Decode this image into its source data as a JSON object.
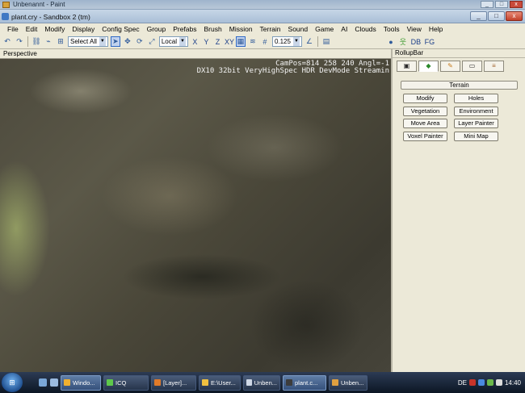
{
  "paint_window": {
    "title": "Unbenannt - Paint",
    "controls": [
      "_",
      "□",
      "x"
    ]
  },
  "sandbox_window": {
    "title": "plant.cry - Sandbox 2 (tm)",
    "controls": [
      "_",
      "□",
      "x"
    ]
  },
  "menu": [
    "File",
    "Edit",
    "Modify",
    "Display",
    "Config Spec",
    "Group",
    "Prefabs",
    "Brush",
    "Mission",
    "Terrain",
    "Sound",
    "Game",
    "AI",
    "Clouds",
    "Tools",
    "View",
    "Help"
  ],
  "toolbar": {
    "select_all": "Select All",
    "coord_system": "Local",
    "axis_x": "X",
    "axis_y": "Y",
    "axis_z": "Z",
    "axis_xy": "XY",
    "grid_value": "0.125",
    "label_db": "DB",
    "label_fg": "FG"
  },
  "viewport": {
    "label": "Perspective",
    "overlay_line1": "CamPos=814 258 240 Angl=-1",
    "overlay_line2": "DX10 32bit VeryHighSpec HDR DevMode Streamin"
  },
  "rollup": {
    "title": "RollupBar",
    "section": "Terrain",
    "buttons": [
      "Modify",
      "Holes",
      "Vegetation",
      "Environment",
      "Move Area",
      "Layer Painter",
      "Voxel Painter",
      "Mini Map"
    ]
  },
  "taskbar": {
    "tasks": [
      "Windo...",
      "ICQ",
      "[Layer]...",
      "E:\\User...",
      "Unben...",
      "plant.c...",
      "Unben..."
    ],
    "language": "DE",
    "clock": "14:40"
  }
}
